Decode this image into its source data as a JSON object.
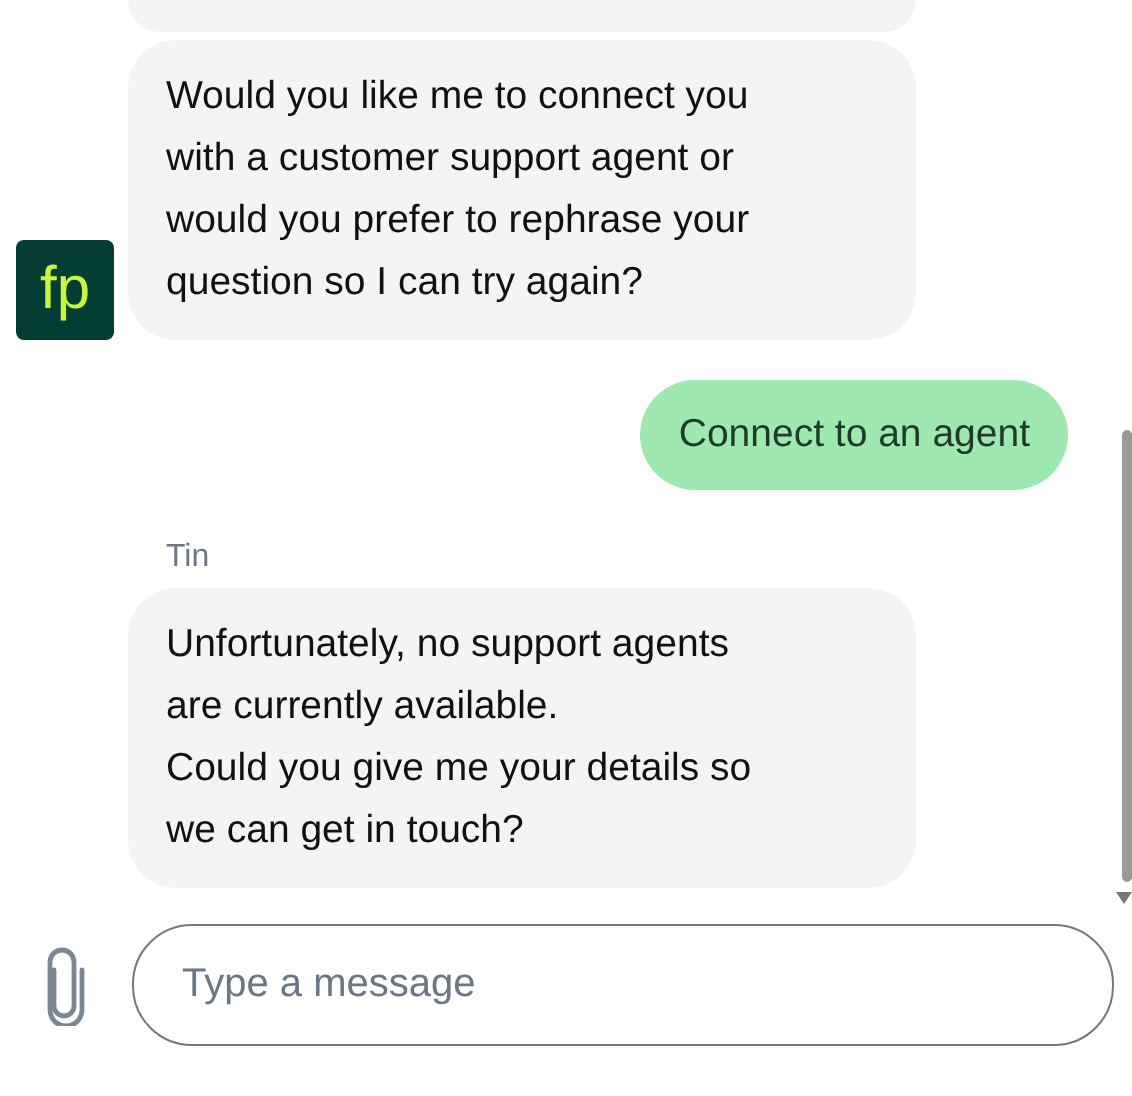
{
  "avatar": {
    "text": "fp"
  },
  "messages": [
    {
      "kind": "bot",
      "cut_off": true
    },
    {
      "kind": "bot",
      "avatar": true,
      "text": "Would you like me to connect you\nwith a customer support agent or\nwould you prefer to rephrase your\nquestion so I can try again?"
    },
    {
      "kind": "user",
      "text": "Connect to an agent"
    },
    {
      "kind": "bot",
      "sender": "Tin",
      "text": "Unfortunately, no support agents\nare currently available.\nCould you give me your details so\nwe can get in touch?"
    }
  ],
  "composer": {
    "placeholder": "Type a message"
  }
}
